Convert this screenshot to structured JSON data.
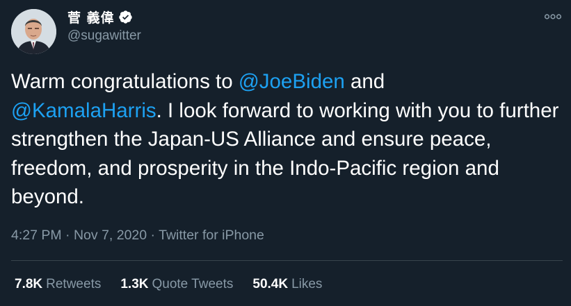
{
  "author": {
    "display_name": "菅 義偉",
    "handle": "@sugawitter",
    "verified": true,
    "avatar_icon": "profile-photo"
  },
  "tweet": {
    "text_parts": [
      "Warm congratulations to ",
      "@JoeBiden",
      " and ",
      "@KamalaHarris",
      ". I look forward to working with you to further strengthen the Japan-US Alliance and ensure peace, freedom, and prosperity in the Indo-Pacific region and beyond."
    ]
  },
  "meta": {
    "time": "4:27 PM",
    "separator": "·",
    "date": "Nov 7, 2020",
    "source": "Twitter for iPhone"
  },
  "stats": {
    "retweets_count": "7.8K",
    "retweets_label": "Retweets",
    "quote_tweets_count": "1.3K",
    "quote_tweets_label": "Quote Tweets",
    "likes_count": "50.4K",
    "likes_label": "Likes"
  },
  "colors": {
    "background": "#15202b",
    "text": "#ffffff",
    "secondary": "#8899a6",
    "accent": "#1da1f2",
    "divider": "#38444d"
  },
  "icons": {
    "verified": "verified-badge-icon",
    "more": "more-options-icon"
  }
}
